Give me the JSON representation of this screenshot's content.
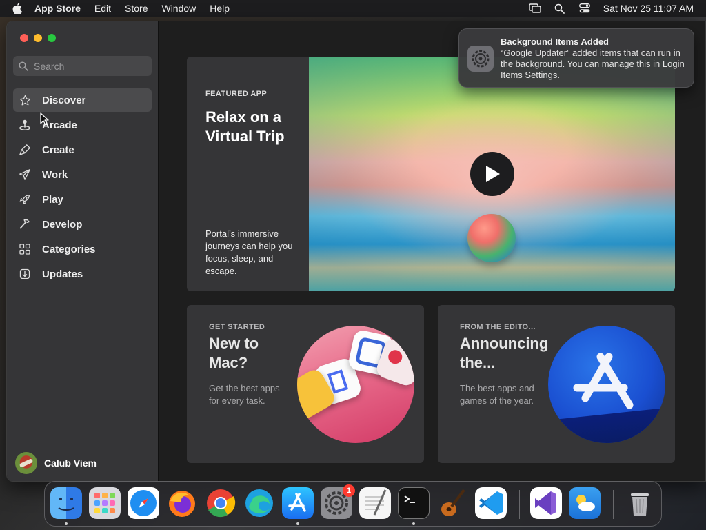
{
  "menubar": {
    "app_name": "App Store",
    "menus": [
      "Edit",
      "Store",
      "Window",
      "Help"
    ],
    "clock": "Sat Nov 25  11:07 AM"
  },
  "sidebar": {
    "search_placeholder": "Search",
    "items": [
      {
        "label": "Discover",
        "icon": "star-icon"
      },
      {
        "label": "Arcade",
        "icon": "joystick-icon"
      },
      {
        "label": "Create",
        "icon": "brush-icon"
      },
      {
        "label": "Work",
        "icon": "paper-plane-icon"
      },
      {
        "label": "Play",
        "icon": "rocket-icon"
      },
      {
        "label": "Develop",
        "icon": "hammer-icon"
      },
      {
        "label": "Categories",
        "icon": "grid-icon"
      },
      {
        "label": "Updates",
        "icon": "download-icon"
      }
    ],
    "user_name": "Calub Viem"
  },
  "hero": {
    "eyebrow": "FEATURED APP",
    "title": "Relax on a Virtual Trip",
    "description": "Portal’s immersive journeys can help you focus, sleep, and escape."
  },
  "cards": [
    {
      "eyebrow": "GET STARTED",
      "title": "New to Mac?",
      "description": "Get the best apps for every task."
    },
    {
      "eyebrow": "FROM THE EDITO...",
      "title": "Announcing the...",
      "description": "The best apps and games of the year."
    }
  ],
  "notification": {
    "title": "Background Items Added",
    "body": "“Google Updater” added items that can run in the background. You can manage this in Login Items Settings."
  },
  "dock": {
    "items": [
      "Finder",
      "Launchpad",
      "Safari",
      "Firefox",
      "Chrome",
      "Edge",
      "App Store",
      "System Settings",
      "TextEdit",
      "Terminal",
      "GarageBand",
      "VS Code",
      "Visual Studio",
      "Weather",
      "Trash"
    ],
    "settings_badge": "1"
  },
  "colors": {
    "accent_red": "#fe5f57",
    "accent_yellow": "#febc2e",
    "accent_green": "#28c840",
    "sidebar_bg": "#353537",
    "window_bg": "#1e1e1e"
  }
}
